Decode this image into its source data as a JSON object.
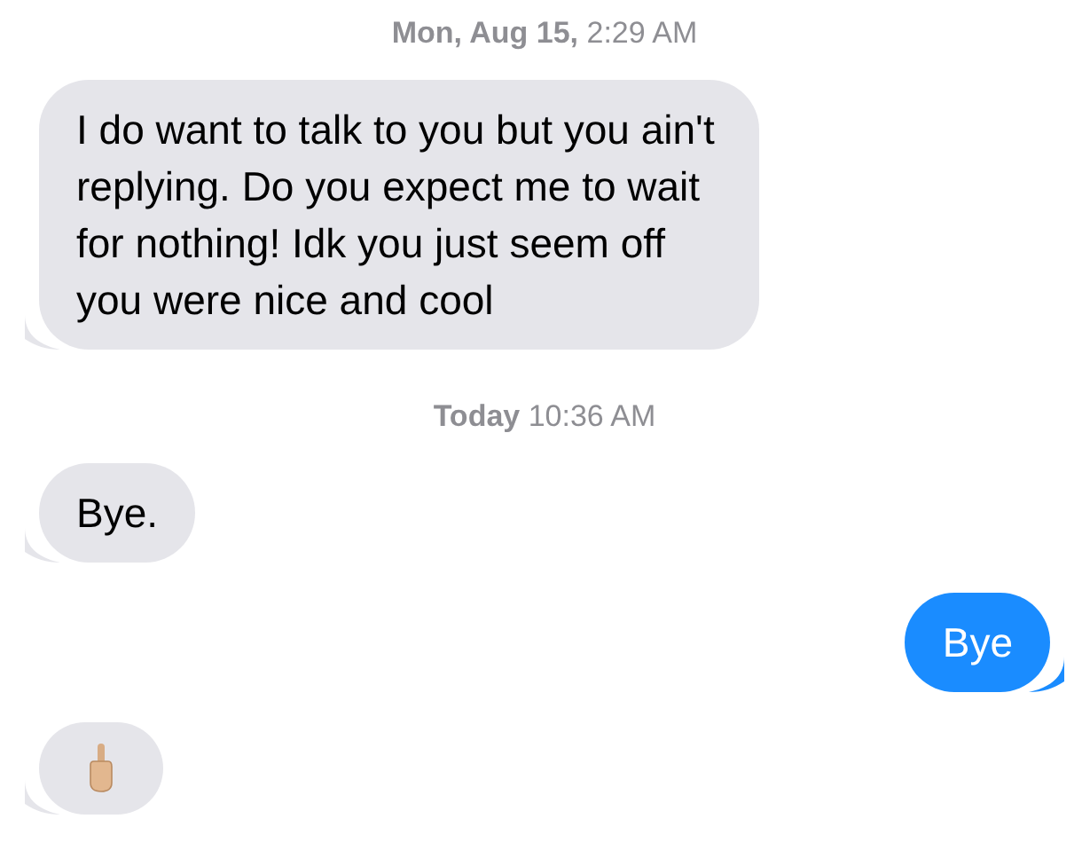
{
  "conversation": [
    {
      "kind": "timestamp",
      "text": "**Mon, Aug 15,** 2:29 AM"
    },
    {
      "kind": "text",
      "outgoing": false,
      "text": "I do want to talk to you but you ain't replying. Do you expect me to wait for nothing! Idk you just seem off you were nice and cool"
    },
    {
      "kind": "timestamp",
      "text": "**Today** 10:36 AM"
    },
    {
      "kind": "text",
      "outgoing": false,
      "text": "Bye."
    },
    {
      "kind": "text",
      "outgoing": true,
      "text": "Bye"
    },
    {
      "kind": "emoji",
      "outgoing": false
    }
  ]
}
